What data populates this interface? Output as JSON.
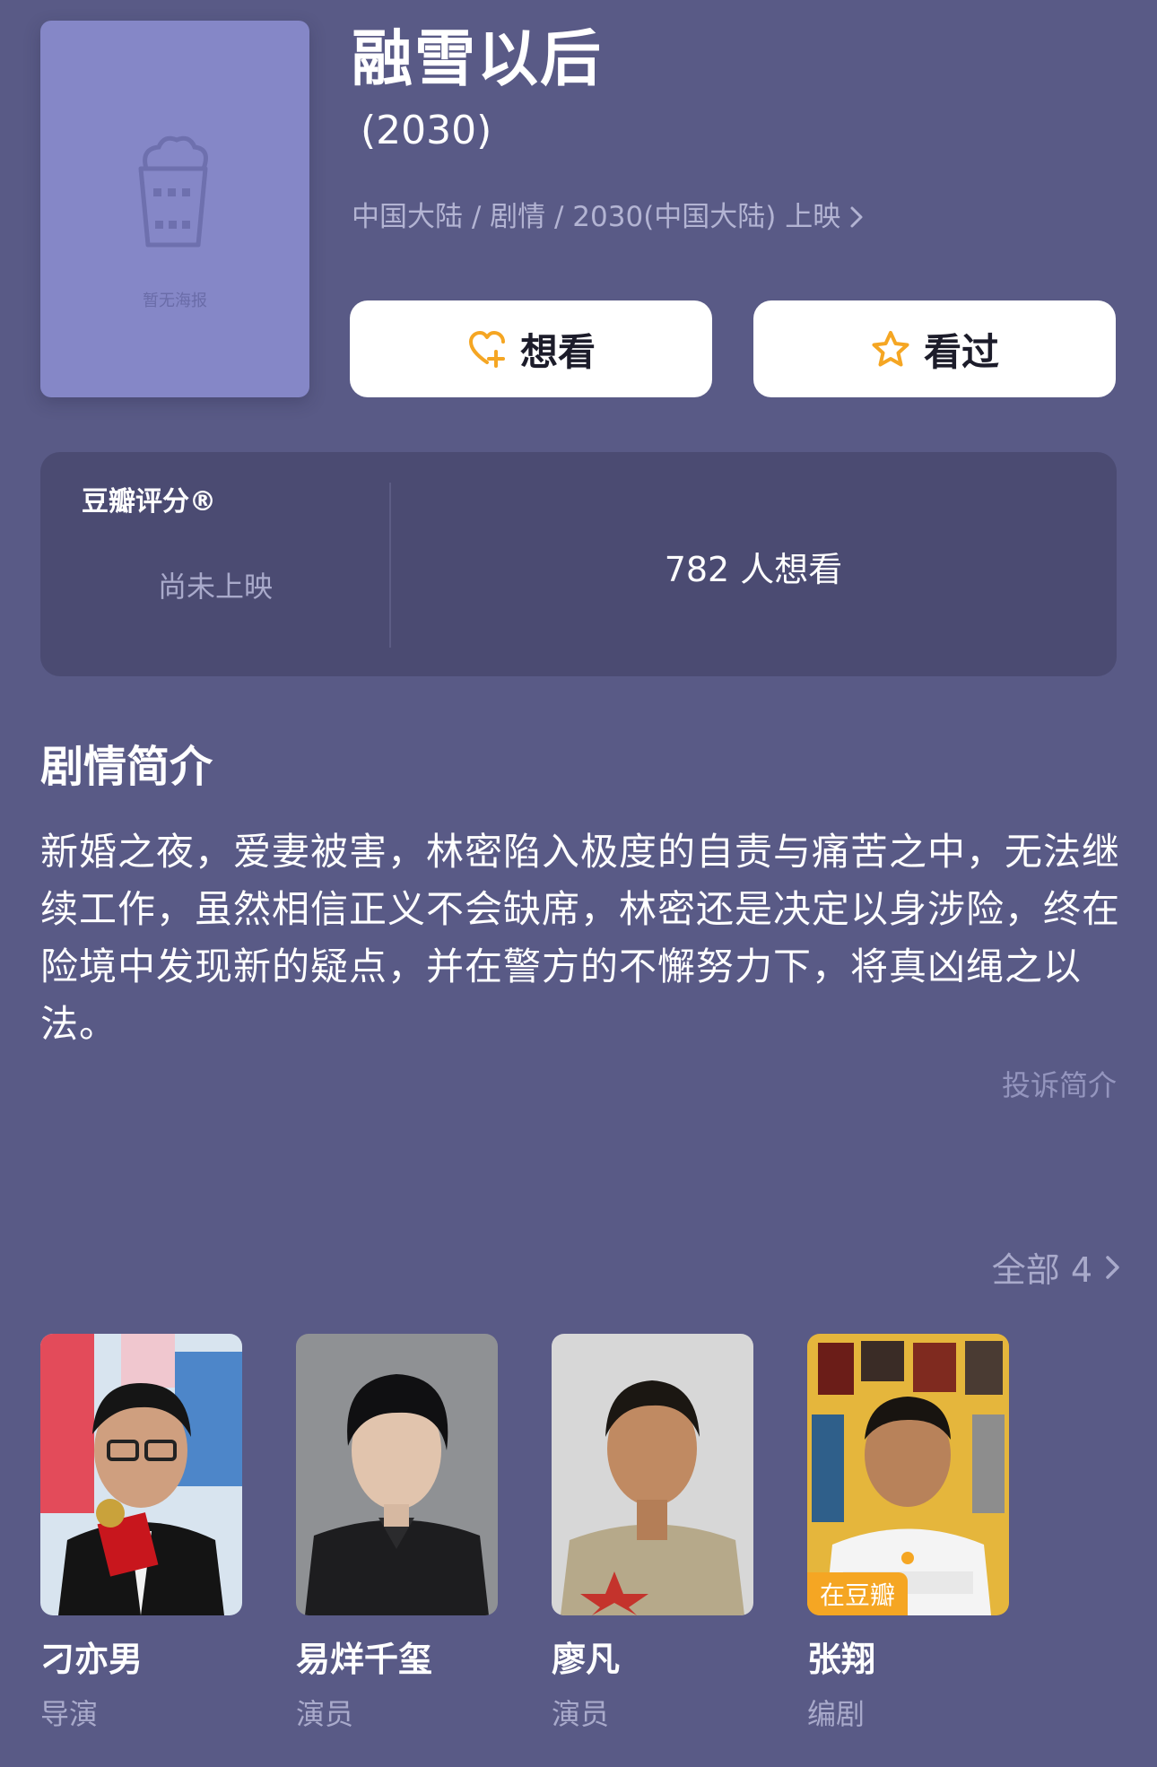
{
  "movie": {
    "poster_placeholder": "暂无海报",
    "title": "融雪以后",
    "year": "(2030)",
    "meta": "中国大陆 / 剧情 / 2030(中国大陆) 上映"
  },
  "actions": {
    "want_label": "想看",
    "seen_label": "看过",
    "accent_color": "#f5a623"
  },
  "rating": {
    "label": "豆瓣评分®",
    "status": "尚未上映",
    "want_count": "782 人想看"
  },
  "synopsis": {
    "heading": "剧情简介",
    "text": "新婚之夜，爱妻被害，林密陷入极度的自责与痛苦之中，无法继续工作，虽然相信正义不会缺席，林密还是决定以身涉险，终在险境中发现新的疑点，并在警方的不懈努力下，将真凶绳之以法。",
    "report": "投诉简介"
  },
  "cast": {
    "all_label": "全部 4",
    "people": [
      {
        "name": "刁亦男",
        "role": "导演"
      },
      {
        "name": "易烊千玺",
        "role": "演员"
      },
      {
        "name": "廖凡",
        "role": "演员"
      },
      {
        "name": "张翔",
        "role": "编剧",
        "badge": "在豆瓣"
      }
    ]
  }
}
